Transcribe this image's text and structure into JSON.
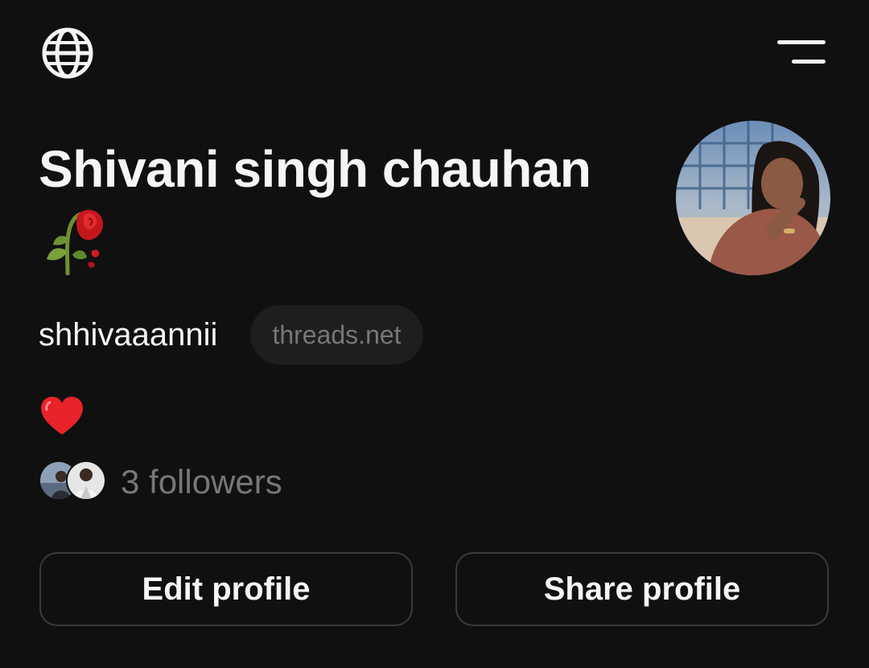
{
  "header": {
    "globe_icon": "globe-icon",
    "menu_icon": "menu-icon"
  },
  "profile": {
    "name": "Shivani singh chauhan",
    "name_emoji": "wilted-rose",
    "username": "shhivaaannii",
    "domain_badge": "threads.net",
    "bio_emoji": "red-heart",
    "followers_text": "3 followers"
  },
  "actions": {
    "edit_label": "Edit profile",
    "share_label": "Share profile"
  },
  "colors": {
    "background": "#101010",
    "text_primary": "#f3f5f7",
    "text_secondary": "#777777",
    "pill_bg": "#1e1e1e",
    "button_border": "#3a3a3a"
  }
}
